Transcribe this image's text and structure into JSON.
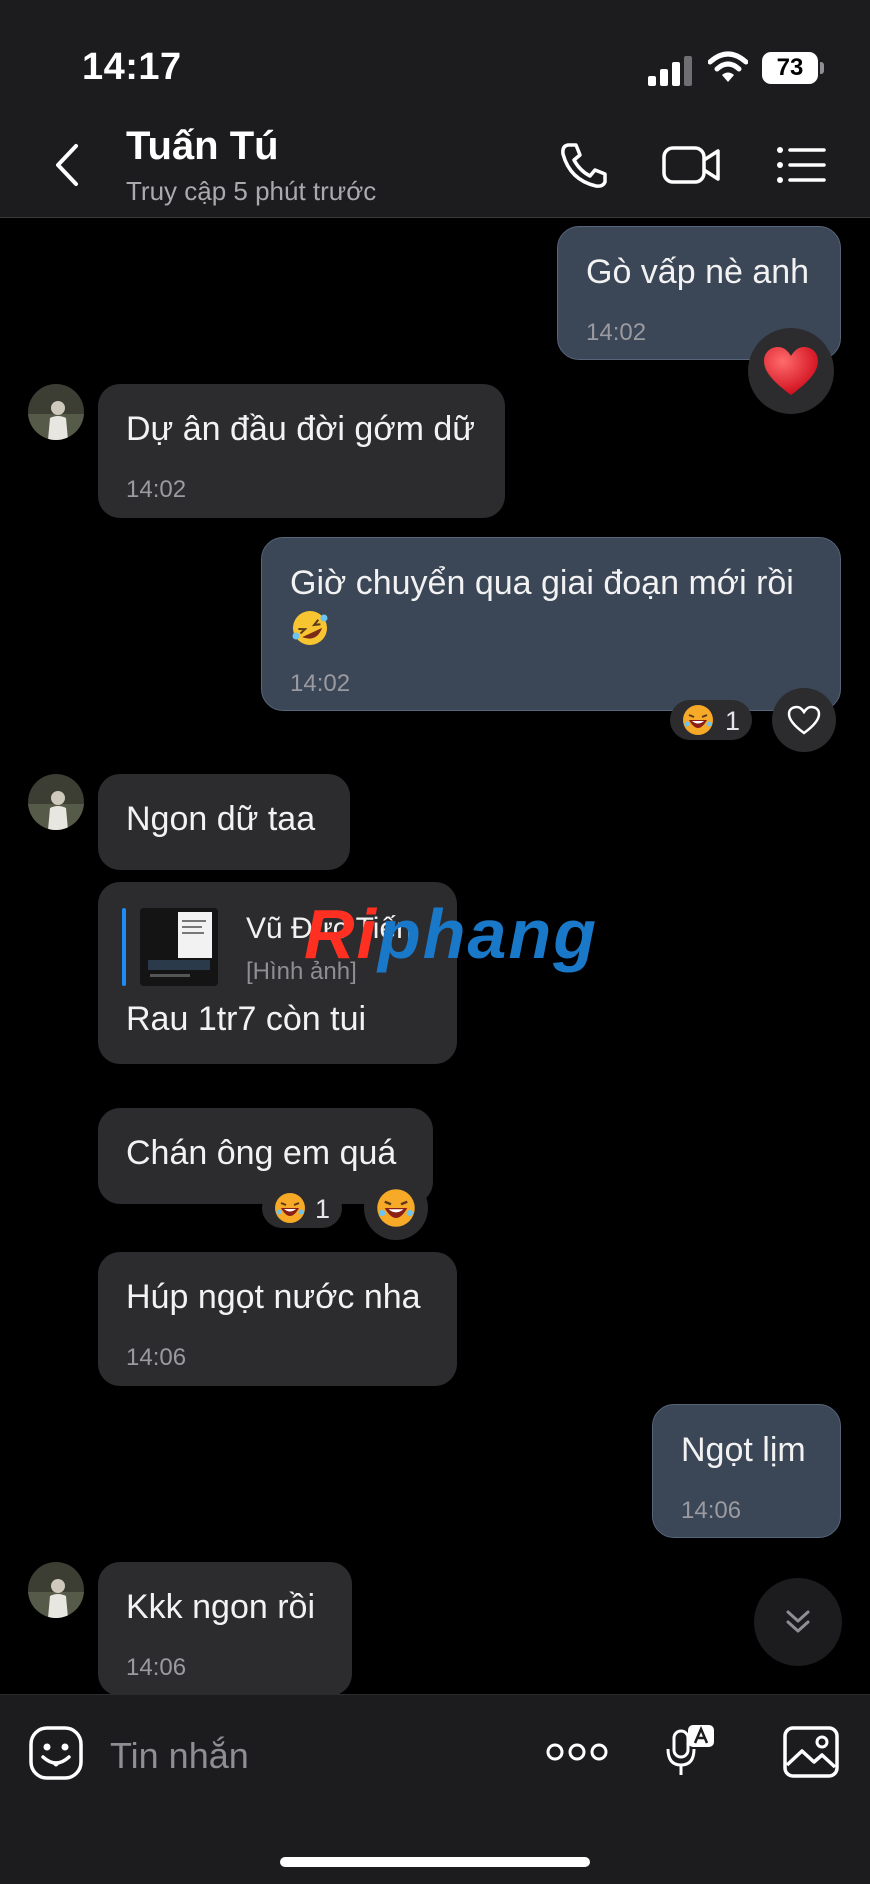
{
  "status_bar": {
    "time": "14:17",
    "battery": "73"
  },
  "header": {
    "contact_name": "Tuấn Tú",
    "contact_status": "Truy cập 5 phút trước"
  },
  "messages": [
    {
      "direction": "out",
      "text": "Gò vấp nè anh",
      "time": "14:02",
      "reaction": "heart"
    },
    {
      "direction": "in",
      "text": "Dự ân đầu đời gớm dữ",
      "time": "14:02"
    },
    {
      "direction": "out",
      "text": "Giờ chuyển qua giai đoạn mới rồi",
      "time": "14:02",
      "reaction": "laugh",
      "reaction_count": "1"
    },
    {
      "direction": "in",
      "text": "Ngon dữ taa"
    },
    {
      "direction": "in",
      "quote_name": "Vũ Đức Tiến",
      "quote_sub": "[Hình ảnh]",
      "text": "Rau 1tr7 còn tui"
    },
    {
      "direction": "in",
      "text": "Chán ông em quá",
      "reaction": "laugh",
      "reaction_count": "1"
    },
    {
      "direction": "in",
      "text": "Húp ngọt nước nha",
      "time": "14:06"
    },
    {
      "direction": "out",
      "text": "Ngọt lịm",
      "time": "14:06"
    },
    {
      "direction": "in",
      "text": "Kkk ngon rồi",
      "time": "14:06"
    }
  ],
  "watermark": {
    "part1": "Ri",
    "part2": "phang"
  },
  "input": {
    "placeholder": "Tin nhắn"
  },
  "icons": {
    "back": "chevron-left-icon",
    "call": "phone-icon",
    "video": "video-camera-icon",
    "menu": "list-menu-icon",
    "emoji": "sticker-smile-icon",
    "more": "more-dots-icon",
    "voice": "voice-to-text-icon",
    "image": "image-icon",
    "scroll": "double-chevron-down-icon",
    "heart": "heart-icon",
    "laugh": "laughing-emoji-icon"
  },
  "colors": {
    "bubble_out": "#3b4656",
    "bubble_in": "#2c2c2e",
    "accent": "#1d8cf5"
  }
}
